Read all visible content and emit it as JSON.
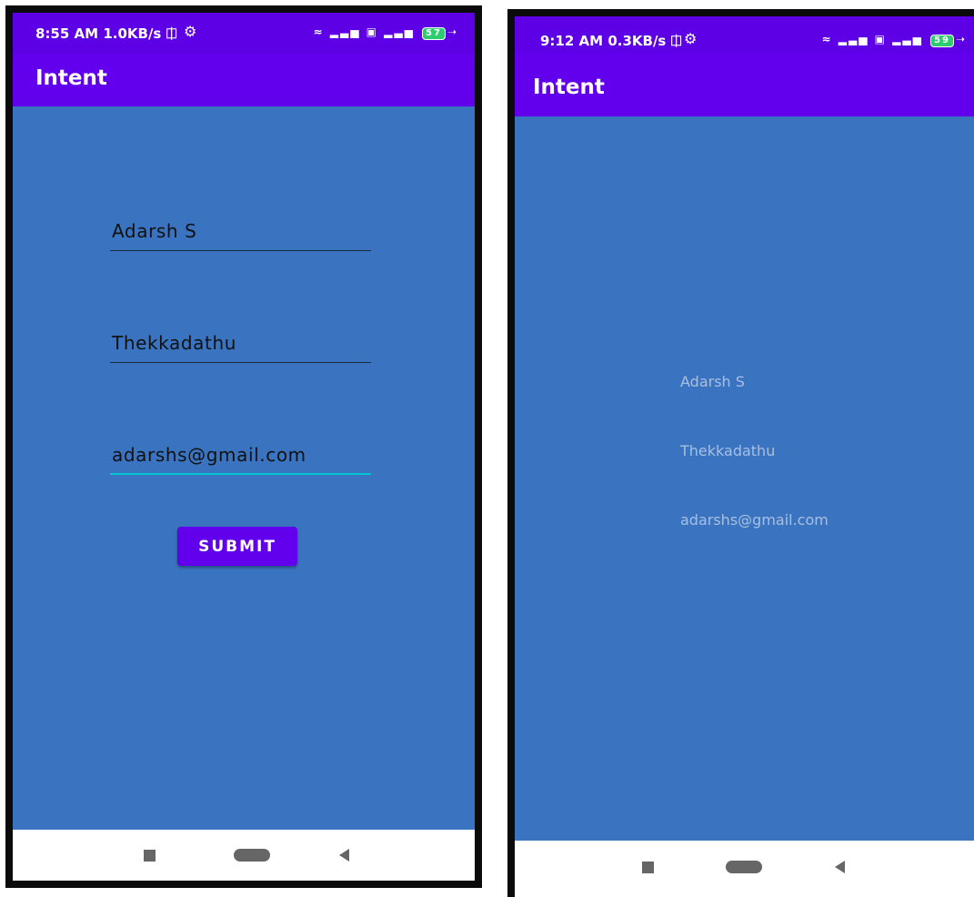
{
  "left_screen": {
    "status_bar": {
      "time": "8:55 AM",
      "speed": "1.0KB/s",
      "icons": "wifi, signal, VoLTE, 4G signal",
      "battery": "57"
    },
    "app_title": "Intent",
    "fields": [
      {
        "value": "Adarsh S"
      },
      {
        "value": "Thekkadathu"
      },
      {
        "value": "adarshs@gmail.com"
      }
    ],
    "submit_label": "SUBMIT"
  },
  "right_screen": {
    "status_bar": {
      "time": "9:12 AM",
      "speed": "0.3KB/s",
      "icons": "wifi, signal, VoLTE, 4G signal",
      "battery": "59"
    },
    "app_title": "Intent",
    "outputs": [
      {
        "text": "Adarsh S"
      },
      {
        "text": "Thekkadathu"
      },
      {
        "text": "adarshs@gmail.com"
      }
    ]
  },
  "colors": {
    "status_bar": "#5d00e6",
    "app_bar": "#6200ee",
    "background": "#3a74c0",
    "accent_focus": "#00c5d4"
  }
}
